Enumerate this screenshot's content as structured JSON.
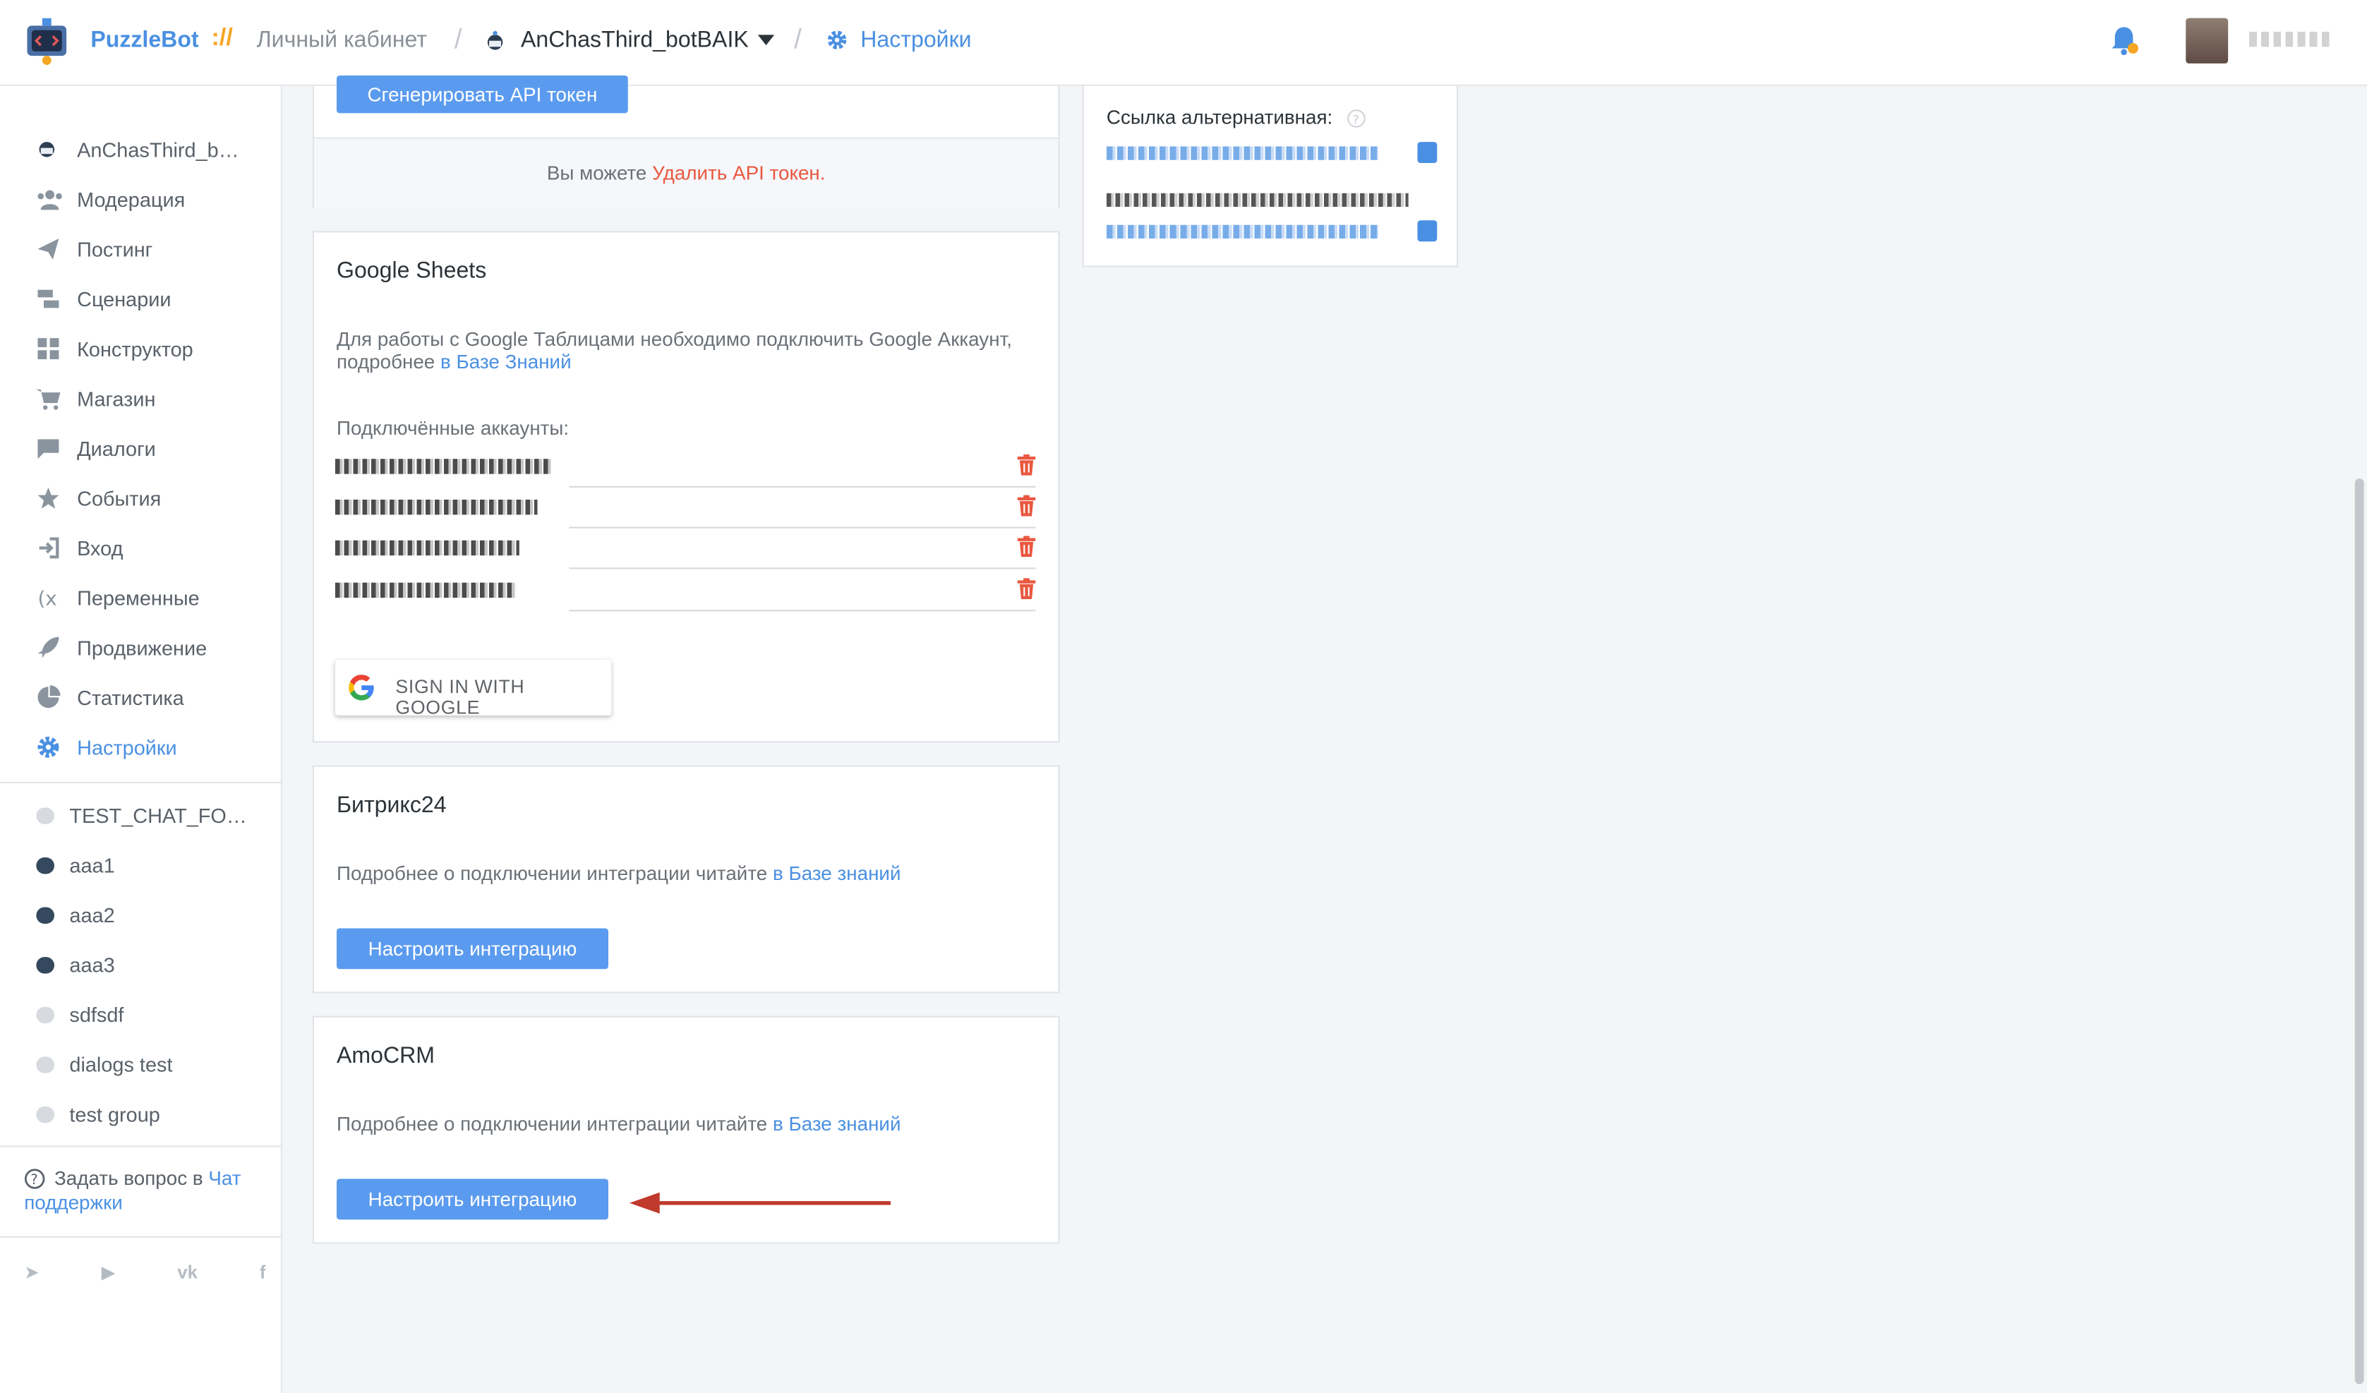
{
  "header": {
    "brand": "PuzzleBot",
    "brand_separator": "://",
    "cabinet": "Личный кабинет",
    "bot_name": "AnChasThird_botBAIK",
    "settings": "Настройки",
    "icons": [
      "puzzlebot-logo-icon",
      "bot-icon",
      "chevron-down-icon",
      "gear-icon",
      "bell-icon"
    ]
  },
  "sidebar": {
    "items": [
      {
        "label": "AnChasThird_b…",
        "icon": "bot-icon"
      },
      {
        "label": "Модерация",
        "icon": "users-icon"
      },
      {
        "label": "Постинг",
        "icon": "paper-plane-icon"
      },
      {
        "label": "Сценарии",
        "icon": "scenarios-icon"
      },
      {
        "label": "Конструктор",
        "icon": "grid-icon"
      },
      {
        "label": "Магазин",
        "icon": "cart-icon"
      },
      {
        "label": "Диалоги",
        "icon": "chat-icon"
      },
      {
        "label": "События",
        "icon": "star-icon"
      },
      {
        "label": "Вход",
        "icon": "sign-in-icon"
      },
      {
        "label": "Переменные",
        "icon": "variable-icon"
      },
      {
        "label": "Продвижение",
        "icon": "rocket-icon"
      },
      {
        "label": "Статистика",
        "icon": "pie-chart-icon"
      },
      {
        "label": "Настройки",
        "icon": "gear-icon",
        "active": true
      }
    ],
    "chats": [
      {
        "label": "TEST_CHAT_FO…",
        "icon": "chat-light-icon"
      },
      {
        "label": "aaa1",
        "icon": "chat-dark-icon"
      },
      {
        "label": "aaa2",
        "icon": "chat-dark-icon"
      },
      {
        "label": "aaa3",
        "icon": "chat-dark-icon"
      },
      {
        "label": "sdfsdf",
        "icon": "chat-light-icon"
      },
      {
        "label": "dialogs test",
        "icon": "chat-light-icon"
      },
      {
        "label": "test group",
        "icon": "chat-light-icon"
      }
    ],
    "help_prefix": "Задать вопрос в",
    "help_link": "Чат поддержки",
    "socials": [
      "telegram-icon",
      "youtube-icon",
      "vk-icon",
      "facebook-icon"
    ]
  },
  "api": {
    "generate_button": "Сгенерировать API токен",
    "delete_prefix": "Вы можете",
    "delete_link": "Удалить API токен."
  },
  "links_card": {
    "alt_label": "Ссылка альтернативная:"
  },
  "google_sheets": {
    "title": "Google Sheets",
    "description": "Для работы с Google Таблицами необходимо подключить Google Аккаунт, подробнее",
    "kb_link": "в Базе Знаний",
    "accounts_label": "Подключённые аккаунты:",
    "accounts_count": 4,
    "sign_in_button": "SIGN IN WITH GOOGLE"
  },
  "bitrix": {
    "title": "Битрикс24",
    "description": "Подробнее о подключении интеграции читайте",
    "kb_link": "в Базе знаний",
    "button": "Настроить интеграцию"
  },
  "amocrm": {
    "title": "AmoCRM",
    "description": "Подробнее о подключении интеграции читайте",
    "kb_link": "в Базе знаний",
    "button": "Настроить интеграцию"
  },
  "colors": {
    "accent": "#4a90e2",
    "button": "#5b9bef",
    "danger": "#e9573f",
    "arrow": "#c0392b"
  }
}
